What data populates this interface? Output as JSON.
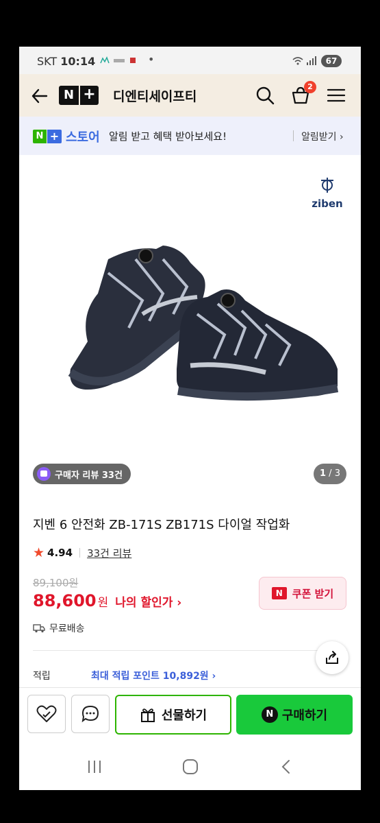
{
  "status_bar": {
    "carrier": "SKT",
    "time": "10:14",
    "dot": "•",
    "battery": "67"
  },
  "header": {
    "store_name": "디엔티세이프티",
    "cart_count": "2",
    "logo": {
      "n": "N",
      "plus": "+"
    }
  },
  "notify_bar": {
    "logo_n": "N",
    "logo_plus": "+",
    "store_label": "스토어",
    "message": "알림 받고 혜택 받아보세요!",
    "action": "알림받기 ›"
  },
  "product": {
    "brand": "ziben",
    "review_chip": "구매자 리뷰 33건",
    "page_current": "1",
    "page_sep": " / ",
    "page_total": "3",
    "title": "지벤 6 안전화 ZB-171S ZB171S 다이얼 작업화",
    "rating": "4.94",
    "review_link": "33건 리뷰",
    "original_price": "89,100원",
    "sale_price": "88,600",
    "sale_unit": "원",
    "my_price_label": "나의 할인가 ›",
    "coupon_label": "쿠폰 받기",
    "coupon_mark": "N",
    "delivery": "무료배송",
    "points_label": "적립",
    "points_value": "최대 적립 포인트 10,892원 ›"
  },
  "actions": {
    "gift_label": "선물하기",
    "buy_label": "구매하기",
    "buy_mark": "N"
  },
  "colors": {
    "accent_green": "#19c93b",
    "naver_green": "#2db400",
    "price_red": "#e0162b",
    "header_bg": "#f4ede2",
    "notify_bg": "#eef0fb"
  },
  "icons": [
    "back-arrow-icon",
    "search-icon",
    "cart-icon",
    "menu-icon",
    "heart-icon",
    "chat-icon",
    "gift-icon",
    "share-icon",
    "truck-icon",
    "star-icon"
  ]
}
